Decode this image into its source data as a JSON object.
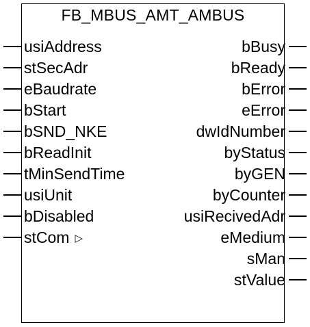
{
  "block": {
    "title": "FB_MBUS_AMT_AMBUS"
  },
  "inputs": [
    {
      "label": "usiAddress"
    },
    {
      "label": "stSecAdr"
    },
    {
      "label": "eBaudrate"
    },
    {
      "label": "bStart"
    },
    {
      "label": "bSND_NKE"
    },
    {
      "label": "bReadInit"
    },
    {
      "label": "tMinSendTime"
    },
    {
      "label": "usiUnit"
    },
    {
      "label": "bDisabled"
    },
    {
      "label": "stCom",
      "inout_marker": "▷"
    }
  ],
  "outputs": [
    {
      "label": "bBusy"
    },
    {
      "label": "bReady"
    },
    {
      "label": "bError"
    },
    {
      "label": "eError"
    },
    {
      "label": "dwIdNumber"
    },
    {
      "label": "byStatus"
    },
    {
      "label": "byGEN"
    },
    {
      "label": "byCounter"
    },
    {
      "label": "usiRecivedAdr"
    },
    {
      "label": "eMedium"
    },
    {
      "label": "sMan"
    },
    {
      "label": "stValue"
    }
  ]
}
